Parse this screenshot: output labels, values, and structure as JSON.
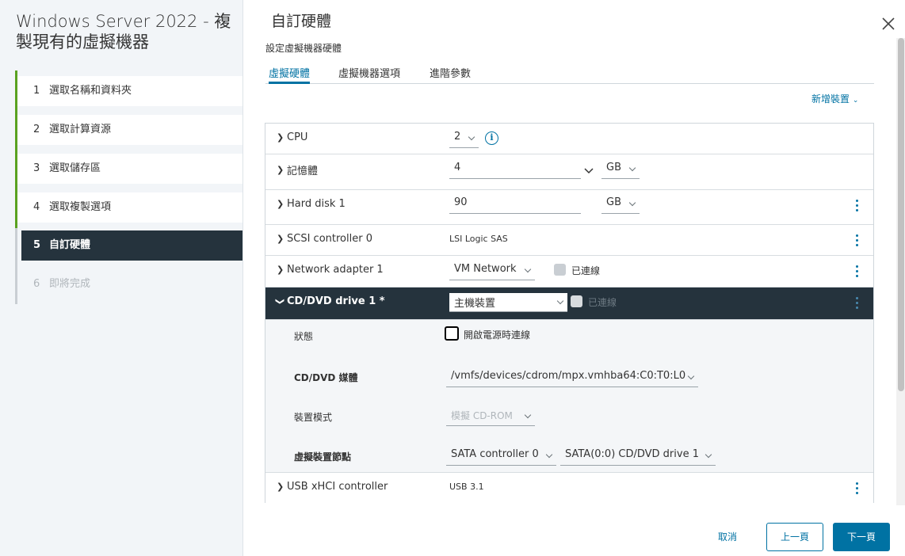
{
  "wizard": {
    "title": "Windows Server 2022 - 複製現有的虛擬機器",
    "steps": [
      {
        "num": "1",
        "label": "選取名稱和資料夾"
      },
      {
        "num": "2",
        "label": "選取計算資源"
      },
      {
        "num": "3",
        "label": "選取儲存區"
      },
      {
        "num": "4",
        "label": "選取複製選項"
      },
      {
        "num": "5",
        "label": "自訂硬體"
      },
      {
        "num": "6",
        "label": "即將完成"
      }
    ]
  },
  "page": {
    "title": "自訂硬體",
    "subtitle": "設定虛擬機器硬體",
    "tabs": [
      "虛擬硬體",
      "虛擬機器選項",
      "進階參數"
    ],
    "add_device": "新增裝置"
  },
  "hardware": {
    "cpu": {
      "label": "CPU",
      "value": "2"
    },
    "memory": {
      "label": "記憶體",
      "value": "4",
      "unit": "GB"
    },
    "disk": {
      "label": "Hard disk 1",
      "value": "90",
      "unit": "GB"
    },
    "scsi": {
      "label": "SCSI controller 0",
      "value": "LSI Logic SAS"
    },
    "network": {
      "label": "Network adapter 1",
      "value": "VM Network",
      "connected_label": "已連線"
    },
    "cdrom": {
      "label": "CD/DVD drive 1 *",
      "value": "主機裝置",
      "connected_label": "已連線",
      "status_label": "狀態",
      "status_check": "開啟電源時連線",
      "media_label": "CD/DVD 媒體",
      "media_value": "/vmfs/devices/cdrom/mpx.vmhba64:C0:T0:L0",
      "mode_label": "裝置模式",
      "mode_value": "模擬 CD-ROM",
      "node_label": "虛擬裝置節點",
      "node_controller": "SATA controller 0",
      "node_value": "SATA(0:0) CD/DVD drive 1"
    },
    "usb": {
      "label": "USB xHCI controller",
      "value": "USB 3.1"
    }
  },
  "footer": {
    "cancel": "取消",
    "prev": "上一頁",
    "next": "下一頁"
  },
  "colors": {
    "accent": "#0072a3",
    "sidebar_active": "#25333d",
    "step_done": "#5aa220"
  }
}
